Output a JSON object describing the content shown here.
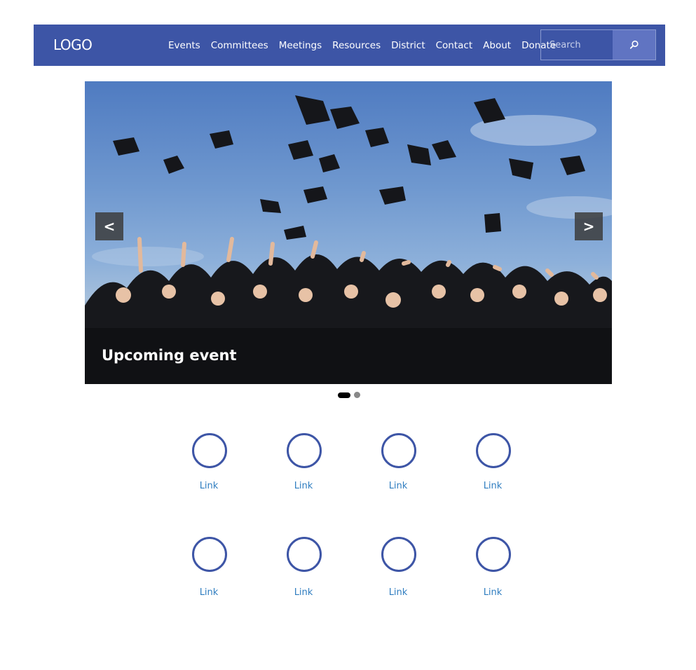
{
  "header": {
    "logo": "LOGO",
    "nav": [
      "Events",
      "Committees",
      "Meetings",
      "Resources",
      "District",
      "Contact",
      "About",
      "Donate"
    ],
    "search": {
      "placeholder": "Search",
      "button_icon": "search-icon"
    },
    "brand_color": "#3d55a6"
  },
  "carousel": {
    "caption": "Upcoming event",
    "prev_label": "<",
    "next_label": ">",
    "slides": 2,
    "active_slide": 1,
    "image": "graduates-throwing-caps"
  },
  "links": {
    "row1": [
      "Link",
      "Link",
      "Link",
      "Link"
    ],
    "row2": [
      "Link",
      "Link",
      "Link",
      "Link"
    ],
    "circle_color": "#3d55a6",
    "label_color": "#2f7dc0"
  }
}
